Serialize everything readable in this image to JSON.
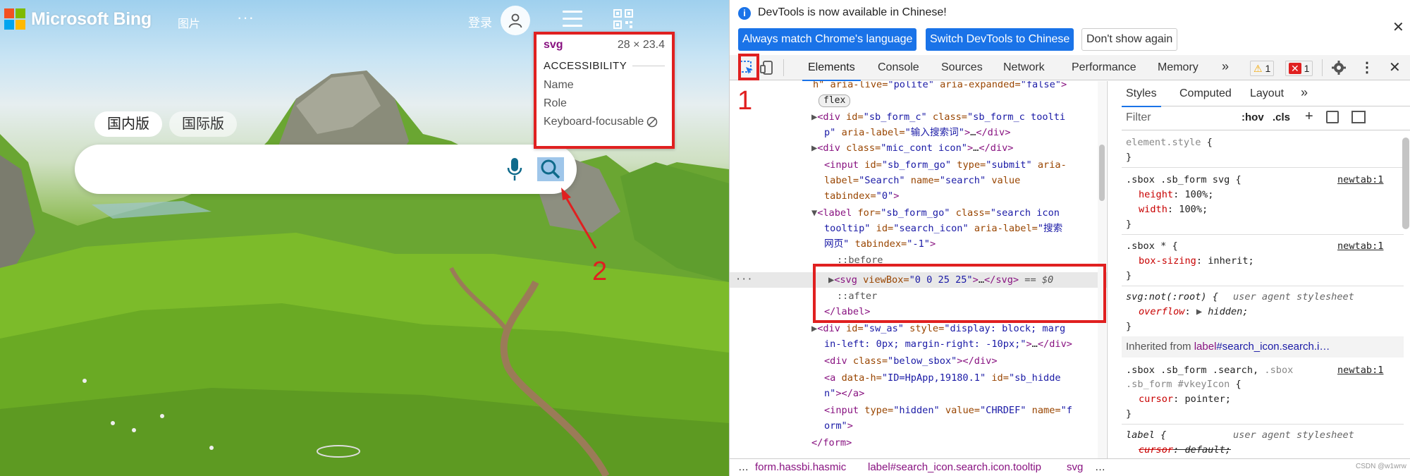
{
  "bing": {
    "logo_text": "Microsoft Bing",
    "nav_images": "图片",
    "nav_more": "···",
    "login": "登录",
    "tabs": [
      "国内版",
      "国际版"
    ],
    "search_placeholder": ""
  },
  "tooltip": {
    "tag": "svg",
    "size": "28 × 23.4",
    "section": "ACCESSIBILITY",
    "rows": [
      "Name",
      "Role",
      "Keyboard-focusable"
    ]
  },
  "annotations": {
    "one": "1",
    "two": "2"
  },
  "devtools": {
    "info_text": "DevTools is now available in Chinese!",
    "buttons": {
      "always_match": "Always match Chrome's language",
      "switch_chinese": "Switch DevTools to Chinese",
      "dont_show": "Don't show again"
    },
    "tabs": [
      "Elements",
      "Console",
      "Sources",
      "Network",
      "Performance",
      "Memory"
    ],
    "more_tabs": "»",
    "warnings": "1",
    "errors": "1",
    "styles_tabs": [
      "Styles",
      "Computed",
      "Layout",
      "»"
    ],
    "filter_placeholder": "Filter",
    "hov": ":hov",
    "cls": ".cls",
    "breadcrumbs": {
      "ellipsis_left": "…",
      "form": "form.hassbi.hasmic",
      "label": "label#search_icon.search.icon.tooltip",
      "svg": "svg",
      "ellipsis_right": "…"
    }
  },
  "colors": {
    "accent": "#1a73e8",
    "annotation_red": "#e02020",
    "tag": "#881280",
    "attr_name": "#994500",
    "attr_value": "#1a1aa6",
    "css_prop": "#c80000"
  },
  "watermark": "CSDN @w1wrw"
}
